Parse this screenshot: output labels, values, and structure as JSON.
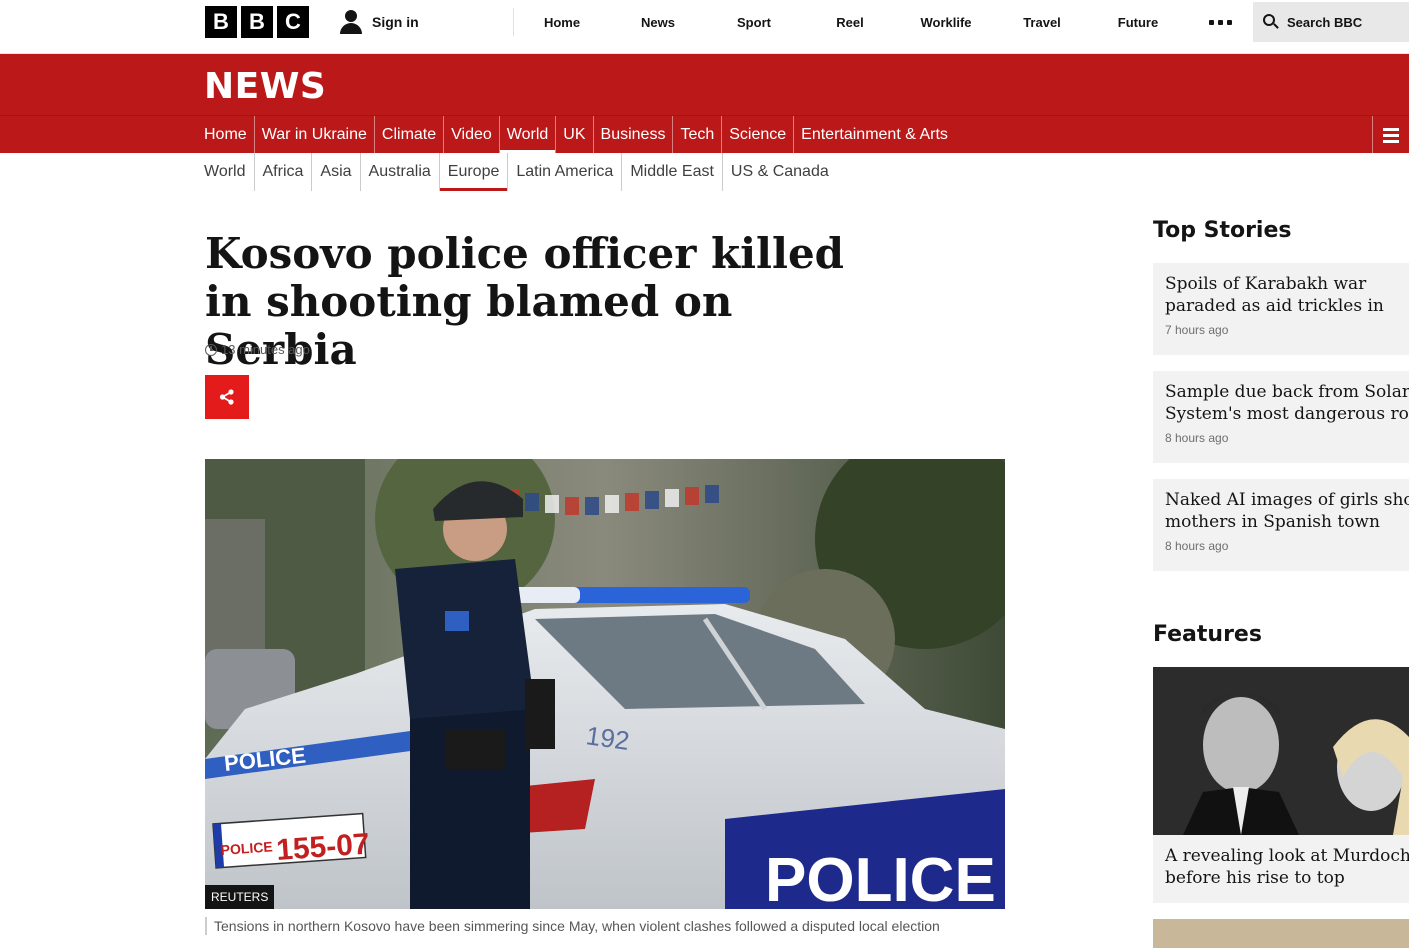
{
  "masthead": {
    "logo_letters": [
      "B",
      "B",
      "C"
    ],
    "signin_label": "Sign in",
    "nav": [
      "Home",
      "News",
      "Sport",
      "Reel",
      "Worklife",
      "Travel",
      "Future"
    ],
    "more_icon": "more-dots-icon",
    "search_label": "Search BBC"
  },
  "banner": {
    "title": "NEWS"
  },
  "section_nav": {
    "items": [
      "Home",
      "War in Ukraine",
      "Climate",
      "Video",
      "World",
      "UK",
      "Business",
      "Tech",
      "Science",
      "Entertainment & Arts"
    ],
    "active": "World"
  },
  "sub_nav": {
    "items": [
      "World",
      "Africa",
      "Asia",
      "Australia",
      "Europe",
      "Latin America",
      "Middle East",
      "US & Canada"
    ],
    "active": "Europe"
  },
  "article": {
    "headline": "Kosovo police officer killed in shooting blamed on Serbia",
    "timestamp": "13 minutes ago",
    "image_credit": "REUTERS",
    "image_plate_left": "POLICE",
    "image_plate_number": "155-07",
    "image_car_text": "POLICE",
    "image_car_number": "192",
    "caption": "Tensions in northern Kosovo have been simmering since May, when violent clashes followed a disputed local election"
  },
  "sidebar": {
    "top_stories_heading": "Top Stories",
    "stories": [
      {
        "title_line1": "Spoils of Karabakh war",
        "title_line2": "paraded as aid trickles in",
        "time": "7 hours ago"
      },
      {
        "title_line1": "Sample due back from Solar",
        "title_line2": "System's most dangerous ro",
        "time": "8 hours ago"
      },
      {
        "title_line1": "Naked AI images of girls sho",
        "title_line2": "mothers in Spanish town",
        "time": "8 hours ago"
      }
    ],
    "features_heading": "Features",
    "feature": {
      "title_line1": "A revealing look at Murdoch",
      "title_line2": "before his rise to top"
    }
  },
  "colors": {
    "brand_red": "#bb1919",
    "share_red": "#e31b1b"
  }
}
